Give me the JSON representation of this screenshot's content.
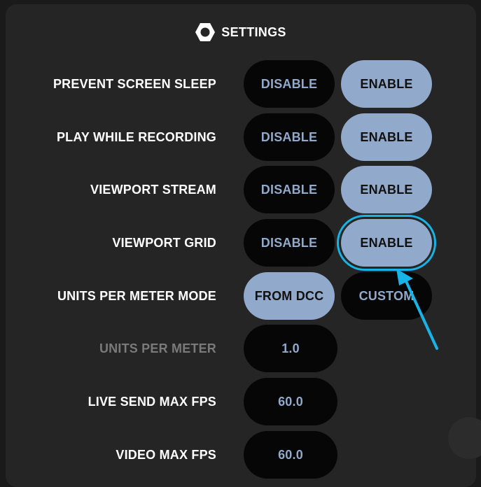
{
  "header": {
    "title": "SETTINGS",
    "icon": "hexagon-settings-icon"
  },
  "settings": {
    "prevent_screen_sleep": {
      "label": "PREVENT SCREEN SLEEP",
      "option_a": "DISABLE",
      "option_b": "ENABLE",
      "selected": "ENABLE"
    },
    "play_while_recording": {
      "label": "PLAY WHILE RECORDING",
      "option_a": "DISABLE",
      "option_b": "ENABLE",
      "selected": "ENABLE"
    },
    "viewport_stream": {
      "label": "VIEWPORT STREAM",
      "option_a": "DISABLE",
      "option_b": "ENABLE",
      "selected": "ENABLE"
    },
    "viewport_grid": {
      "label": "VIEWPORT GRID",
      "option_a": "DISABLE",
      "option_b": "ENABLE",
      "selected": "ENABLE"
    },
    "units_per_meter_mode": {
      "label": "UNITS PER METER MODE",
      "option_a": "FROM DCC",
      "option_b": "CUSTOM",
      "selected": "FROM DCC"
    },
    "units_per_meter": {
      "label": "UNITS PER METER",
      "value": "1.0",
      "enabled": false
    },
    "live_send_max_fps": {
      "label": "LIVE SEND MAX FPS",
      "value": "60.0"
    },
    "video_max_fps": {
      "label": "VIDEO MAX FPS",
      "value": "60.0"
    }
  },
  "colors": {
    "accent": "#91a9cb",
    "highlight": "#17b4e8",
    "panel": "#252525"
  }
}
